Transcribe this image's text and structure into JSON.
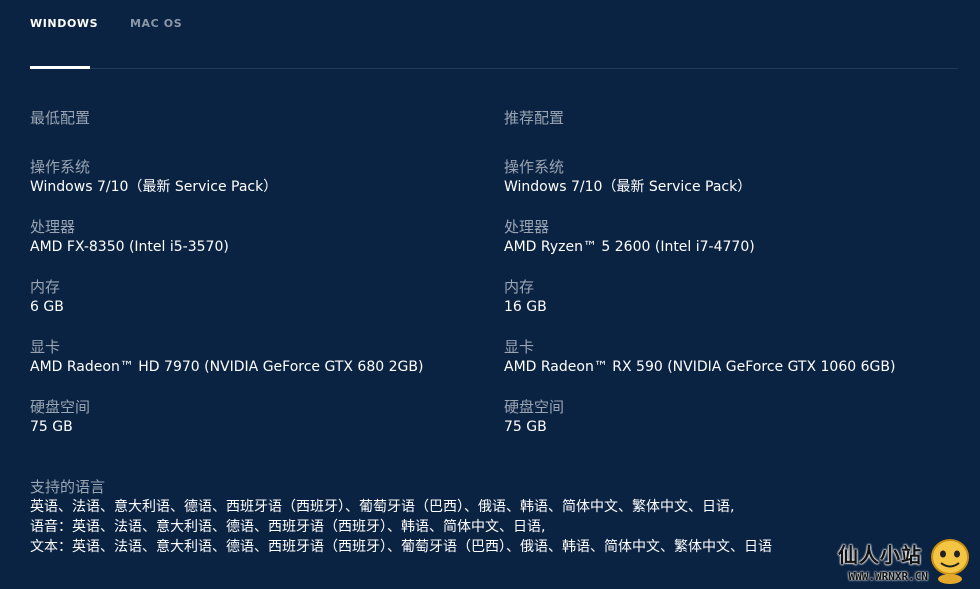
{
  "tabs": [
    {
      "label": "WINDOWS",
      "active": true
    },
    {
      "label": "MAC OS",
      "active": false
    }
  ],
  "minimum": {
    "title": "最低配置",
    "specs": [
      {
        "label": "操作系统",
        "value": "Windows 7/10（最新 Service Pack）"
      },
      {
        "label": "处理器",
        "value": "AMD FX-8350 (Intel i5-3570)"
      },
      {
        "label": "内存",
        "value": "6 GB"
      },
      {
        "label": "显卡",
        "value": "AMD Radeon™ HD 7970 (NVIDIA GeForce GTX 680 2GB)"
      },
      {
        "label": "硬盘空间",
        "value": "75 GB"
      }
    ]
  },
  "recommended": {
    "title": "推荐配置",
    "specs": [
      {
        "label": "操作系统",
        "value": "Windows 7/10（最新 Service Pack）"
      },
      {
        "label": "处理器",
        "value": "AMD Ryzen™ 5 2600 (Intel i7-4770)"
      },
      {
        "label": "内存",
        "value": "16 GB"
      },
      {
        "label": "显卡",
        "value": "AMD Radeon™ RX 590 (NVIDIA GeForce GTX 1060 6GB)"
      },
      {
        "label": "硬盘空间",
        "value": "75 GB"
      }
    ]
  },
  "languages": {
    "label": "支持的语言",
    "lines": [
      "英语、法语、意大利语、德语、西班牙语（西班牙）、葡萄牙语（巴西）、俄语、韩语、简体中文、繁体中文、日语,",
      "语音：英语、法语、意大利语、德语、西班牙语（西班牙）、韩语、简体中文、日语,",
      "文本：英语、法语、意大利语、德语、西班牙语（西班牙）、葡萄牙语（巴西）、俄语、韩语、简体中文、繁体中文、日语"
    ]
  },
  "watermark": {
    "text": "仙人小站",
    "url": "WWW.WRNXR.CN"
  },
  "colors": {
    "background": "#0b2342",
    "label": "#9aa5b3",
    "value": "#ffffff",
    "tab_inactive": "#8a97a8"
  }
}
